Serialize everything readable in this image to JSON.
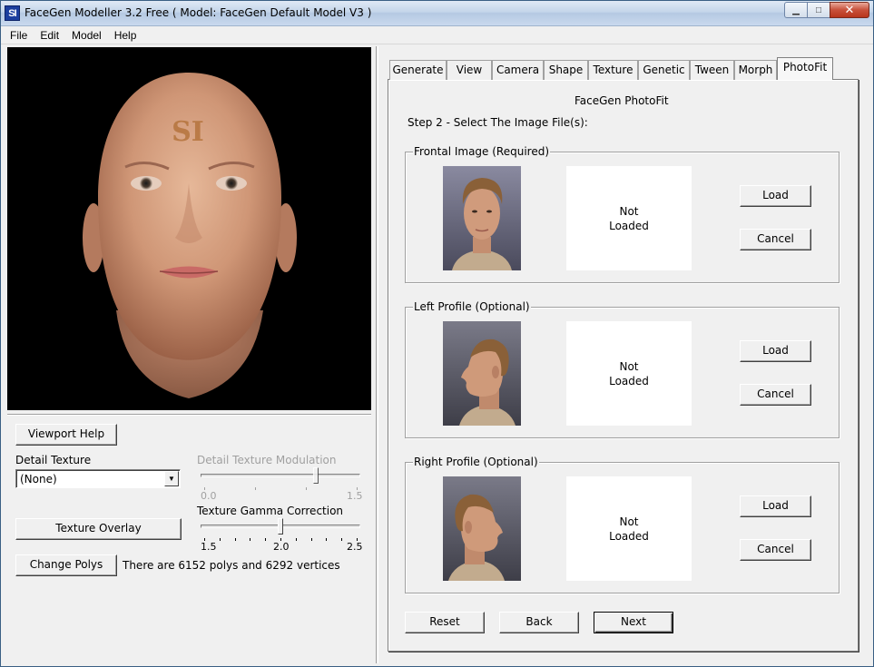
{
  "window": {
    "icon_text": "SI",
    "title": "FaceGen Modeller 3.2 Free  ( Model: FaceGen Default Model V3 )",
    "controls": {
      "minimize": "▁",
      "maximize": "□",
      "close": "✕"
    }
  },
  "menu": [
    {
      "label": "File"
    },
    {
      "label": "Edit"
    },
    {
      "label": "Model"
    },
    {
      "label": "Help"
    }
  ],
  "viewport": {
    "forehead_logo": "SI"
  },
  "left_panel": {
    "viewport_help_label": "Viewport Help",
    "detail_texture": {
      "label": "Detail Texture",
      "selected": "(None)"
    },
    "detail_texture_modulation": {
      "label": "Detail Texture Modulation",
      "min_label": "0.0",
      "max_label": "1.5",
      "min": 0.0,
      "max": 1.5,
      "value": 1.1,
      "enabled": false
    },
    "texture_overlay_label": "Texture Overlay",
    "texture_gamma_correction": {
      "label": "Texture Gamma Correction",
      "min_label": "1.5",
      "mid_label": "2.0",
      "max_label": "2.5",
      "min": 1.5,
      "max": 2.5,
      "value": 2.0,
      "enabled": true
    },
    "change_polys_label": "Change Polys",
    "poly_info": "There are 6152 polys and 6292 vertices"
  },
  "tabs": [
    {
      "label": "Generate",
      "active": false
    },
    {
      "label": "View",
      "active": false
    },
    {
      "label": "Camera",
      "active": false
    },
    {
      "label": "Shape",
      "active": false
    },
    {
      "label": "Texture",
      "active": false
    },
    {
      "label": "Genetic",
      "active": false
    },
    {
      "label": "Tween",
      "active": false
    },
    {
      "label": "Morph",
      "active": false
    },
    {
      "label": "PhotoFit",
      "active": true
    }
  ],
  "photofit": {
    "heading": "FaceGen PhotoFit",
    "step": "Step 2 - Select The Image File(s):",
    "groups": [
      {
        "label": "Frontal Image (Required)",
        "status_line1": "Not",
        "status_line2": "Loaded",
        "load_label": "Load",
        "cancel_label": "Cancel",
        "example": "frontal-face-example"
      },
      {
        "label": "Left Profile (Optional)",
        "status_line1": "Not",
        "status_line2": "Loaded",
        "load_label": "Load",
        "cancel_label": "Cancel",
        "example": "left-profile-example"
      },
      {
        "label": "Right Profile (Optional)",
        "status_line1": "Not",
        "status_line2": "Loaded",
        "load_label": "Load",
        "cancel_label": "Cancel",
        "example": "right-profile-example"
      }
    ],
    "reset_label": "Reset",
    "back_label": "Back",
    "next_label": "Next"
  }
}
